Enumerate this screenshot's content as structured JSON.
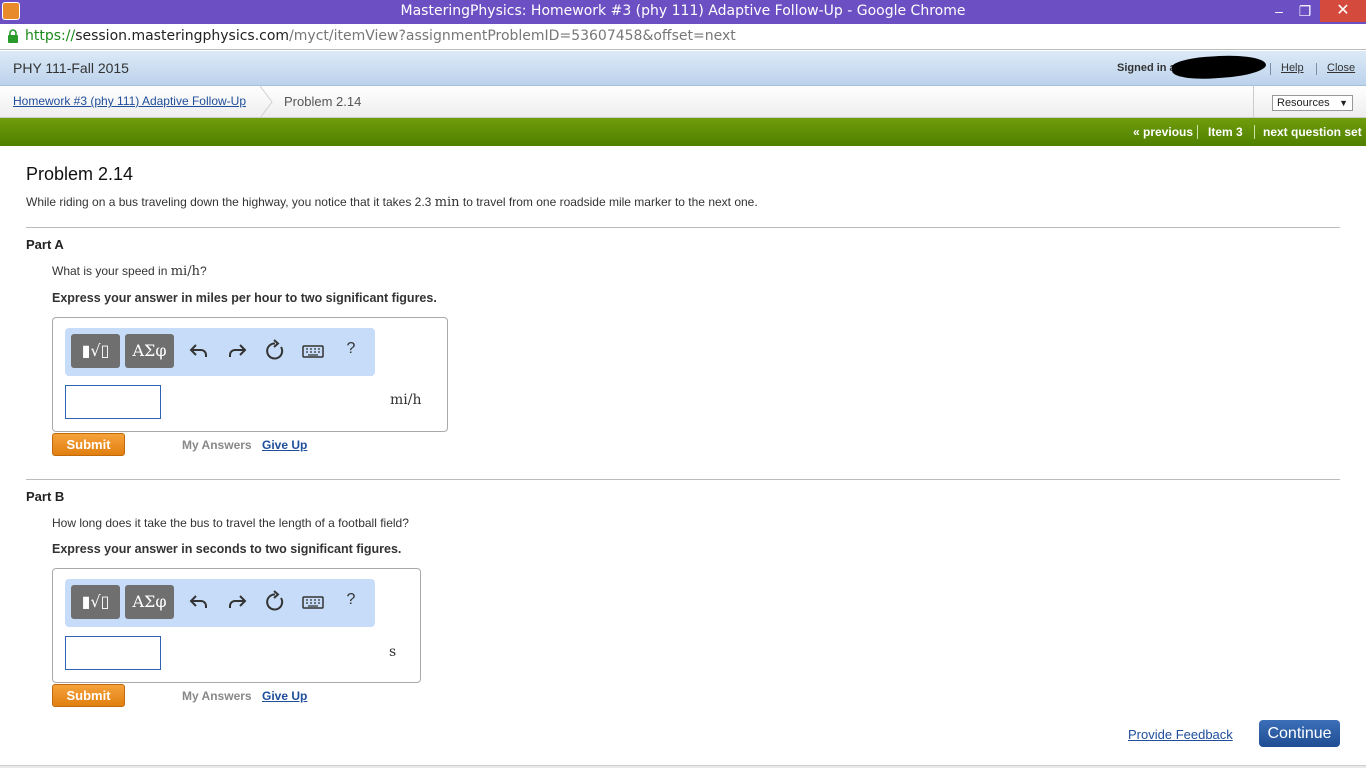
{
  "window": {
    "title": "MasteringPhysics: Homework #3 (phy 111) Adaptive Follow-Up - Google Chrome",
    "controls": {
      "minimize": "‒",
      "maximize": "❐",
      "close": "✕"
    }
  },
  "address_bar": {
    "scheme": "https://",
    "host": "session.masteringphysics.com",
    "path": "/myct/itemView?assignmentProblemID=53607458&offset=next"
  },
  "header": {
    "course": "PHY 111-Fall 2015",
    "signed_in": "Signed in as",
    "help": "Help",
    "close": "Close"
  },
  "breadcrumb": {
    "assignment": "Homework #3 (phy 111) Adaptive Follow-Up",
    "current": "Problem 2.14",
    "resources": "Resources",
    "resources_caret": "▼"
  },
  "nav": {
    "previous": "« previous",
    "item": "Item 3",
    "next": "next question set"
  },
  "problem": {
    "title": "Problem 2.14",
    "text_before": "While riding on a bus traveling down the highway, you notice that it takes 2.3 ",
    "text_unit": "min",
    "text_after": " to travel from one roadside mile marker to the next one."
  },
  "parts": [
    {
      "label": "Part A",
      "question_before": "What is your speed in ",
      "question_unit": "mi/h",
      "question_after": "?",
      "instruction": "Express your answer in miles per hour to two significant figures.",
      "answer_value": "",
      "unit": "mi/h",
      "submit": "Submit",
      "my_answers": "My Answers",
      "give_up": "Give Up"
    },
    {
      "label": "Part B",
      "question": "How long does it take the bus to travel the length of a football field?",
      "instruction": "Express your answer in seconds to two significant figures.",
      "answer_value": "",
      "unit": "s",
      "submit": "Submit",
      "my_answers": "My Answers",
      "give_up": "Give Up"
    }
  ],
  "toolbar": {
    "templates_label": "▮√▯",
    "greek_label": "ΑΣφ",
    "help_label": "?",
    "icons": [
      "templates-icon",
      "greek-symbols-icon",
      "undo-icon",
      "redo-icon",
      "reset-icon",
      "keyboard-icon",
      "help-icon"
    ]
  },
  "footer": {
    "feedback": "Provide Feedback",
    "continue": "Continue"
  },
  "colors": {
    "title_bar": "#6b4fc3",
    "nav_green": "#5a8a04",
    "submit_orange": "#ef8f22",
    "continue_blue": "#2a5aa4",
    "link_blue": "#1f4e9a"
  }
}
